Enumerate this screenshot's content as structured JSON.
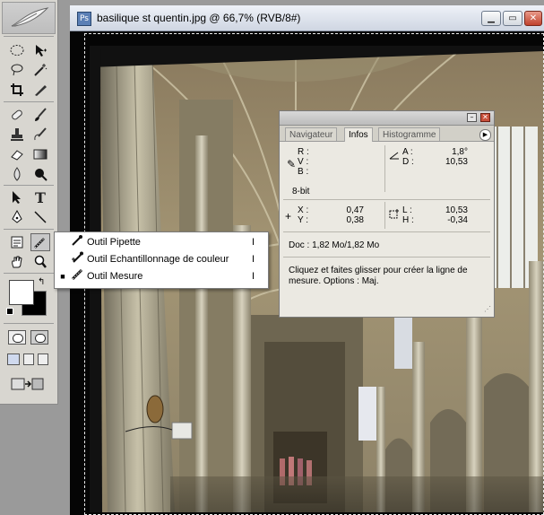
{
  "document": {
    "title": "basilique st quentin.jpg @ 66,7% (RVB/8#)",
    "buttons": [
      "minimize",
      "maximize",
      "close"
    ]
  },
  "toolbox": {
    "tools": [
      "marquee-icon",
      "move-icon",
      "lasso-icon",
      "magic-wand-icon",
      "crop-icon",
      "slice-icon",
      "healing-brush-icon",
      "brush-icon",
      "clone-stamp-icon",
      "history-brush-icon",
      "eraser-icon",
      "gradient-icon",
      "blur-icon",
      "dodge-icon",
      "path-select-icon",
      "type-icon",
      "pen-icon",
      "line-icon",
      "notes-icon",
      "eyedropper-icon",
      "hand-icon",
      "zoom-icon"
    ],
    "foreground": "#ffffff",
    "background": "#000000"
  },
  "flyout": {
    "items": [
      {
        "label": "Outil Pipette",
        "shortcut": "I",
        "selected": false
      },
      {
        "label": "Outil Echantillonnage de couleur",
        "shortcut": "I",
        "selected": false
      },
      {
        "label": "Outil Mesure",
        "shortcut": "I",
        "selected": true
      }
    ]
  },
  "info_panel": {
    "tabs": [
      "Navigateur",
      "Infos",
      "Histogramme"
    ],
    "active_tab": "Infos",
    "rgb_labels": [
      "R :",
      "V :",
      "B :"
    ],
    "angle_label": "A :",
    "angle_value": "1,8°",
    "distance_label": "D :",
    "distance_value": "10,53",
    "bit_depth": "8-bit",
    "x_label": "X :",
    "x_value": "0,47",
    "y_label": "Y :",
    "y_value": "0,38",
    "l_label": "L :",
    "l_value": "10,53",
    "h_label": "H :",
    "h_value": "-0,34",
    "doc_size": "Doc : 1,82 Mo/1,82 Mo",
    "hint_line1": "Cliquez et faites glisser pour créer la ligne de",
    "hint_line2": "mesure. Options : Maj."
  }
}
